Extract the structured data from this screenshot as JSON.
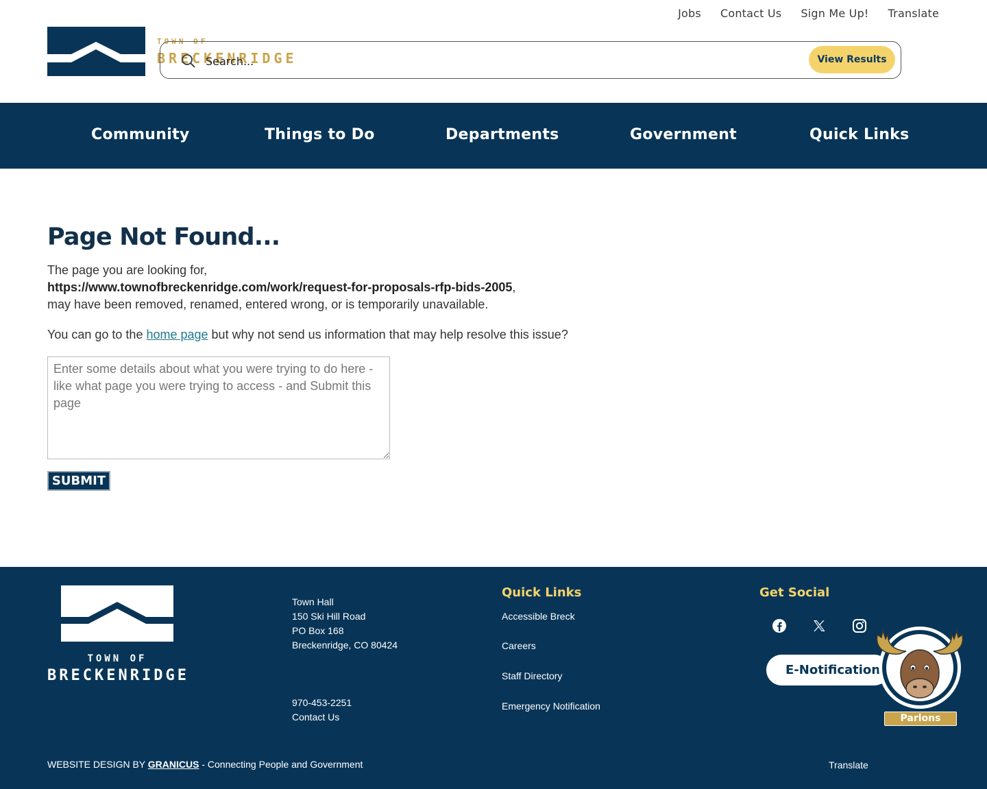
{
  "utility_nav": [
    "Jobs",
    "Contact Us",
    "Sign Me Up!",
    "Translate"
  ],
  "logo": {
    "town_of": "TOWN OF",
    "name": "BRECKENRIDGE"
  },
  "search": {
    "placeholder": "Search...",
    "button": "View Results"
  },
  "main_nav": [
    "Community",
    "Things to Do",
    "Departments",
    "Government",
    "Quick Links"
  ],
  "content": {
    "title": "Page Not Found...",
    "intro": "The page you are looking for,",
    "url": "https://www.townofbreckenridge.com/work/request-for-proposals-rfp-bids-2005",
    "url_suffix": ",",
    "reason": "may have been removed, renamed, entered wrong, or is temporarily unavailable.",
    "goto_prefix": "You can go to the ",
    "home_link": "home page",
    "goto_suffix": " but why not send us information that may help resolve this issue?",
    "textarea_placeholder": "Enter some details about what you were trying to do here - like what page you were trying to access - and Submit this page",
    "submit": "SUBMIT"
  },
  "footer": {
    "logo": {
      "town_of": "TOWN OF",
      "name": "BRECKENRIDGE"
    },
    "address": [
      "Town Hall",
      "150 Ski Hill Road",
      "PO Box 168",
      "Breckenridge, CO 80424"
    ],
    "phone": "970-453-2251",
    "contact": "Contact Us",
    "quick_links_title": "Quick Links",
    "quick_links": [
      "Accessible Breck",
      "Careers",
      "Staff Directory",
      "Emergency Notification"
    ],
    "social_title": "Get Social",
    "social_icons": [
      "facebook-icon",
      "x-twitter-icon",
      "instagram-icon"
    ],
    "enotifications": "E-Notifications",
    "mascot_label": "Parlons",
    "credit_prefix": "WEBSITE DESIGN BY ",
    "credit_link": "GRANICUS",
    "credit_suffix": " - Connecting People and Government",
    "translate": "Translate"
  },
  "colors": {
    "navy": "#083557",
    "gold": "#c9a44c",
    "yellow": "#f5d36b",
    "link": "#1d7a8c"
  }
}
